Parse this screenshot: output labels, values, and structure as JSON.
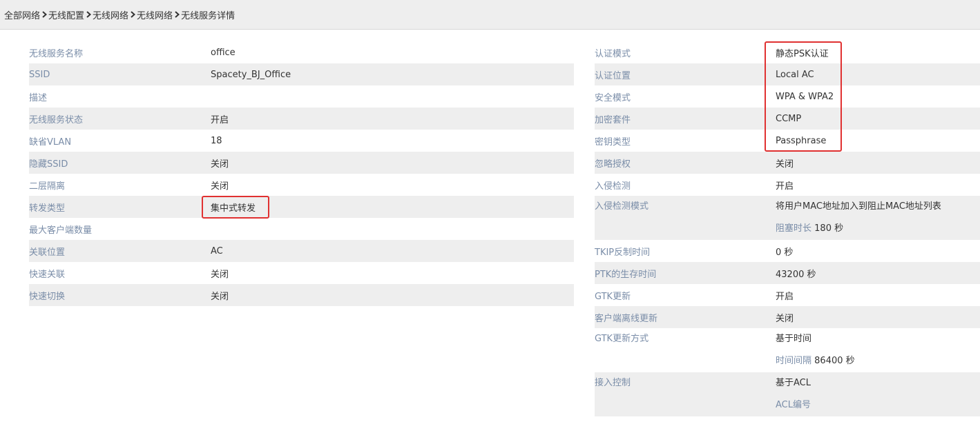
{
  "breadcrumb": {
    "items": [
      "全部网络",
      "无线配置",
      "无线网络",
      "无线网络",
      "无线服务详情"
    ]
  },
  "left_panel": {
    "rows": [
      {
        "label": "无线服务名称",
        "value": "office"
      },
      {
        "label": "SSID",
        "value": "Spacety_BJ_Office"
      },
      {
        "label": "描述",
        "value": ""
      },
      {
        "label": "无线服务状态",
        "value": "开启"
      },
      {
        "label": "缺省VLAN",
        "value": "18"
      },
      {
        "label": "隐藏SSID",
        "value": "关闭"
      },
      {
        "label": "二层隔离",
        "value": "关闭"
      },
      {
        "label": "转发类型",
        "value": "集中式转发"
      },
      {
        "label": "最大客户端数量",
        "value": ""
      },
      {
        "label": "关联位置",
        "value": "AC"
      },
      {
        "label": "快速关联",
        "value": "关闭"
      },
      {
        "label": "快速切换",
        "value": "关闭"
      }
    ]
  },
  "right_panel": {
    "rows": [
      {
        "label": "认证模式",
        "value": "静态PSK认证"
      },
      {
        "label": "认证位置",
        "value": "Local AC"
      },
      {
        "label": "安全模式",
        "value": "WPA & WPA2"
      },
      {
        "label": "加密套件",
        "value": "CCMP"
      },
      {
        "label": "密钥类型",
        "value": "Passphrase"
      },
      {
        "label": "忽略授权",
        "value": "关闭"
      },
      {
        "label": "入侵检测",
        "value": "开启"
      },
      {
        "label": "入侵检测模式",
        "value": "将用户MAC地址加入到阻止MAC地址列表",
        "sub_label": "阻塞时长",
        "sub_value": "180 秒"
      },
      {
        "label": "TKIP反制时间",
        "value": "0 秒"
      },
      {
        "label": "PTK的生存时间",
        "value": "43200 秒"
      },
      {
        "label": "GTK更新",
        "value": "开启"
      },
      {
        "label": "客户端离线更新",
        "value": "关闭"
      },
      {
        "label": "GTK更新方式",
        "value": "基于时间",
        "sub_label": "时间间隔",
        "sub_value": "86400 秒"
      },
      {
        "label": "接入控制",
        "value": "基于ACL",
        "sub_label": "ACL编号",
        "sub_value": ""
      }
    ]
  },
  "colors": {
    "label": "#7a8da8",
    "value": "#333333",
    "row_alt_bg": "#eeeeee",
    "highlight_border": "#e03030"
  }
}
